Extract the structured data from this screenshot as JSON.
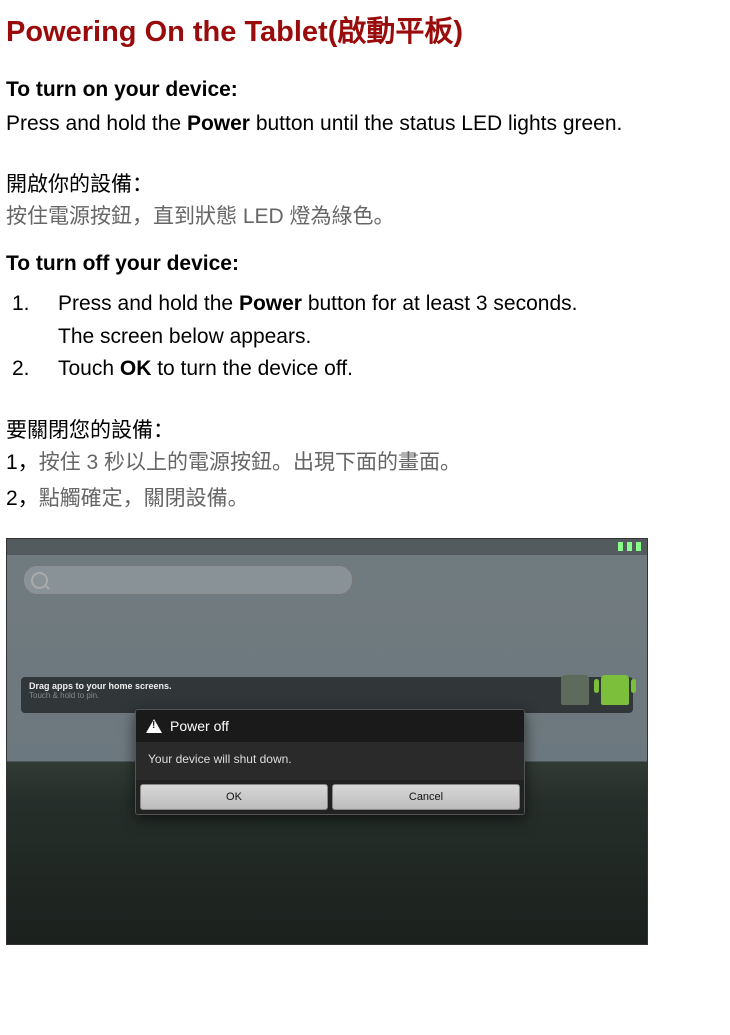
{
  "title_en": "Powering On the Tablet(",
  "title_zh": "啟動平板",
  "title_close": ")",
  "turn_on_head": "To turn on your device:",
  "turn_on_para_1": "Press and hold the ",
  "turn_on_para_bold": "Power",
  "turn_on_para_2": " button until the status LED lights green.",
  "zh_on_head": "開啟你的設備：",
  "zh_on_body": "按住電源按鈕，直到狀態 LED 燈為綠色。",
  "turn_off_head": "To turn off your device:",
  "off_steps": [
    {
      "idx": "1.",
      "pre": "Press and hold the ",
      "bold": "Power",
      "post": " button for at least 3 seconds."
    },
    {
      "idx": "2.",
      "pre": "Touch ",
      "bold": "OK",
      "post": " to turn the device off."
    }
  ],
  "off_step1_sub": "The screen below appears.",
  "zh_off_head": "要關閉您的設備：",
  "zh_off_1_num": "1，",
  "zh_off_1_txt": "按住 3 秒以上的電源按鈕。出現下面的畫面。",
  "zh_off_2_num": "2，",
  "zh_off_2_txt": "點觸確定，關閉設備。",
  "screenshot": {
    "shelf_line1": "Drag apps to your home screens.",
    "shelf_line2": "Touch & hold to pin.",
    "dialog_title": "Power off",
    "dialog_body": "Your device will shut down.",
    "ok": "OK",
    "cancel": "Cancel"
  }
}
